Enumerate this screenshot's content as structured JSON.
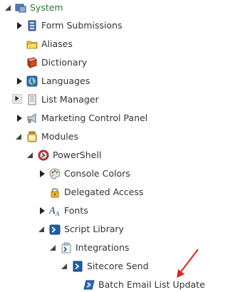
{
  "tree": {
    "system": {
      "label": "System",
      "icon": "system-icon"
    },
    "form_submissions": {
      "label": "Form Submissions",
      "icon": "form-icon"
    },
    "aliases": {
      "label": "Aliases",
      "icon": "folder-icon"
    },
    "dictionary": {
      "label": "Dictionary",
      "icon": "book-icon"
    },
    "languages": {
      "label": "Languages",
      "icon": "globe-icon"
    },
    "list_manager": {
      "label": "List Manager",
      "icon": "list-icon"
    },
    "marketing_control_panel": {
      "label": "Marketing Control Panel",
      "icon": "megaphone-icon"
    },
    "modules": {
      "label": "Modules",
      "icon": "jar-icon"
    },
    "powershell": {
      "label": "PowerShell",
      "icon": "powershell-icon"
    },
    "console_colors": {
      "label": "Console Colors",
      "icon": "palette-icon"
    },
    "delegated_access": {
      "label": "Delegated Access",
      "icon": "lock-icon"
    },
    "fonts": {
      "label": "Fonts",
      "icon": "fonts-icon"
    },
    "script_library": {
      "label": "Script Library",
      "icon": "script-library-icon"
    },
    "integrations": {
      "label": "Integrations",
      "icon": "integrations-icon"
    },
    "sitecore_send": {
      "label": "Sitecore Send",
      "icon": "script-module-icon"
    },
    "batch_email_list_update": {
      "label": "Batch Email List Update",
      "icon": "script-icon"
    }
  },
  "colors": {
    "root_label": "#2a7a2a",
    "annotation_arrow": "#e02020",
    "powershell_blue": "#1f5fa8"
  }
}
